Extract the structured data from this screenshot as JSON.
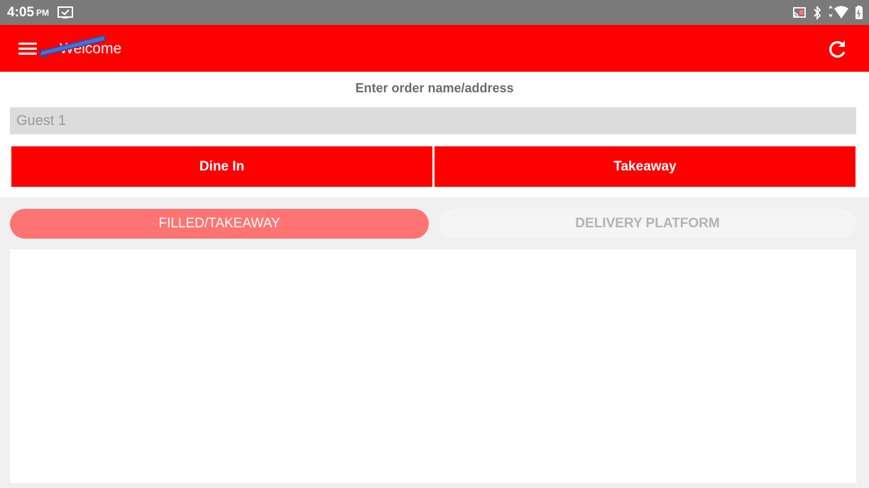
{
  "status_bar": {
    "time": "4:05",
    "ampm": "PM",
    "notification_icon": "monitor-check-icon",
    "icons": [
      "cast-icon",
      "bluetooth-icon",
      "wifi-icon",
      "battery-icon"
    ]
  },
  "app_bar": {
    "title": "Welcome",
    "menu_icon": "hamburger-menu-icon",
    "refresh_icon": "refresh-icon",
    "color": "#ff0000"
  },
  "order": {
    "label": "Enter order name/address",
    "placeholder": "Guest 1",
    "value": ""
  },
  "order_types": {
    "dine_in": "Dine In",
    "takeaway": "Takeaway"
  },
  "tabs": [
    {
      "label": "FILLED/TAKEAWAY",
      "active": true
    },
    {
      "label": "DELIVERY PLATFORM",
      "active": false
    }
  ],
  "colors": {
    "primary": "#ff0000",
    "tab_active": "#ff7373",
    "status_bar": "#7a7a7a",
    "annotation_arrow": "#4a6fd4"
  }
}
